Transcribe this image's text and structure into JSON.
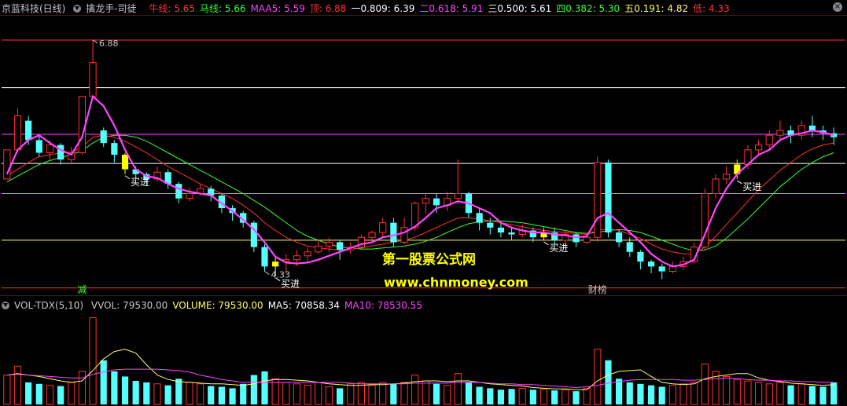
{
  "main_header": {
    "stock_name": "京蓝科技(日线)",
    "indicator_name": "擒龙手-司徒",
    "items": [
      {
        "label": "牛线: 5.65",
        "color": "#ff3333"
      },
      {
        "label": "马线: 5.66",
        "color": "#33ff33"
      },
      {
        "label": "MAA5: 5.59",
        "color": "#ff44ff"
      },
      {
        "label": "顶: 6.88",
        "color": "#ff3333"
      },
      {
        "label": "一0.809: 6.39",
        "color": "#ffffff"
      },
      {
        "label": "二0.618: 5.91",
        "color": "#ff44ff"
      },
      {
        "label": "三0.500: 5.61",
        "color": "#ffffff"
      },
      {
        "label": "四0.382: 5.30",
        "color": "#33ff33"
      },
      {
        "label": "五0.191: 4.82",
        "color": "#ffff66"
      },
      {
        "label": "低: 4.33",
        "color": "#ff3333"
      }
    ]
  },
  "sub_header": {
    "indicator_name": "VOL-TDX(5,10)",
    "items": [
      {
        "label": "VVOL: 79530.00",
        "color": "#c8c8c8"
      },
      {
        "label": "VOLUME: 79530.00",
        "color": "#ffff66"
      },
      {
        "label": "MA5: 70858.34",
        "color": "#ffffff"
      },
      {
        "label": "MA10: 78530.55",
        "color": "#ff44ff"
      }
    ]
  },
  "annotations": {
    "high_label": "6.88",
    "low_label": "4.33",
    "buy_label": "买进",
    "reduce_label": "减",
    "board_label": "财榜"
  },
  "watermark": {
    "line1": "第一股票公式网",
    "line2": "www.chnmoney.com"
  },
  "colors": {
    "up": "#ff3232",
    "down": "#54ffff",
    "signal": "#ffff00",
    "maa": "#ff44ff",
    "bull": "#ff3333",
    "horse": "#33ff33"
  },
  "chart_data": {
    "type": "candlestick",
    "price_levels": [
      {
        "name": "顶",
        "value": 6.88
      },
      {
        "name": "0.809",
        "value": 6.39
      },
      {
        "name": "0.618",
        "value": 5.91
      },
      {
        "name": "0.500",
        "value": 5.61
      },
      {
        "name": "0.382",
        "value": 5.3
      },
      {
        "name": "0.191",
        "value": 4.82
      },
      {
        "name": "低",
        "value": 4.33
      }
    ],
    "ylim": [
      4.27,
      7.13
    ],
    "candles": [
      [
        5.45,
        5.75,
        5.75,
        5.45
      ],
      [
        5.75,
        6.1,
        6.18,
        5.72
      ],
      [
        6.05,
        5.85,
        6.1,
        5.8
      ],
      [
        5.85,
        5.72,
        5.9,
        5.68
      ],
      [
        5.72,
        5.8,
        5.85,
        5.65
      ],
      [
        5.8,
        5.65,
        5.82,
        5.6
      ],
      [
        5.65,
        5.72,
        5.78,
        5.6
      ],
      [
        5.72,
        6.3,
        6.3,
        5.7
      ],
      [
        6.3,
        6.65,
        6.88,
        6.28
      ],
      [
        5.95,
        5.82,
        5.98,
        5.78
      ],
      [
        5.82,
        5.7,
        5.85,
        5.62
      ],
      [
        5.7,
        5.55,
        5.72,
        5.5
      ],
      [
        5.55,
        5.5,
        5.58,
        5.45
      ],
      [
        5.5,
        5.45,
        5.52,
        5.38
      ],
      [
        5.45,
        5.52,
        5.58,
        5.42
      ],
      [
        5.52,
        5.4,
        5.55,
        5.35
      ],
      [
        5.4,
        5.25,
        5.42,
        5.2
      ],
      [
        5.25,
        5.3,
        5.36,
        5.22
      ],
      [
        5.3,
        5.35,
        5.4,
        5.28
      ],
      [
        5.35,
        5.28,
        5.38,
        5.22
      ],
      [
        5.28,
        5.15,
        5.3,
        5.1
      ],
      [
        5.15,
        5.1,
        5.18,
        5.02
      ],
      [
        5.1,
        5.0,
        5.12,
        4.95
      ],
      [
        5.0,
        4.75,
        5.02,
        4.7
      ],
      [
        4.75,
        4.55,
        4.78,
        4.5
      ],
      [
        4.55,
        4.6,
        4.65,
        4.45
      ],
      [
        4.6,
        4.62,
        4.68,
        4.48
      ],
      [
        4.62,
        4.66,
        4.72,
        4.55
      ],
      [
        4.66,
        4.7,
        4.75,
        4.6
      ],
      [
        4.7,
        4.76,
        4.82,
        4.68
      ],
      [
        4.76,
        4.8,
        4.85,
        4.7
      ],
      [
        4.8,
        4.72,
        4.82,
        4.62
      ],
      [
        4.72,
        4.75,
        4.8,
        4.68
      ],
      [
        4.75,
        4.85,
        4.88,
        4.72
      ],
      [
        4.85,
        4.9,
        4.92,
        4.8
      ],
      [
        4.9,
        5.0,
        5.05,
        4.85
      ],
      [
        5.0,
        4.8,
        5.05,
        4.75
      ],
      [
        4.8,
        4.95,
        5.05,
        4.78
      ],
      [
        4.95,
        5.2,
        5.22,
        4.92
      ],
      [
        5.2,
        5.25,
        5.3,
        5.1
      ],
      [
        5.25,
        5.18,
        5.3,
        5.1
      ],
      [
        5.18,
        5.25,
        5.32,
        5.12
      ],
      [
        5.25,
        5.3,
        5.65,
        5.2
      ],
      [
        5.3,
        5.1,
        5.32,
        5.05
      ],
      [
        5.1,
        5.0,
        5.15,
        4.92
      ],
      [
        5.0,
        4.95,
        5.05,
        4.88
      ],
      [
        4.95,
        4.9,
        5.0,
        4.85
      ],
      [
        4.9,
        4.88,
        4.95,
        4.82
      ],
      [
        4.88,
        4.92,
        4.98,
        4.85
      ],
      [
        4.92,
        4.85,
        4.95,
        4.8
      ],
      [
        4.85,
        4.9,
        4.95,
        4.82
      ],
      [
        4.9,
        4.82,
        4.95,
        4.75
      ],
      [
        4.82,
        4.88,
        4.92,
        4.78
      ],
      [
        4.88,
        4.8,
        4.9,
        4.75
      ],
      [
        4.8,
        4.85,
        4.9,
        4.78
      ],
      [
        4.85,
        5.62,
        5.68,
        4.8
      ],
      [
        5.62,
        4.9,
        5.65,
        4.85
      ],
      [
        4.9,
        4.8,
        4.92,
        4.75
      ],
      [
        4.8,
        4.7,
        4.85,
        4.65
      ],
      [
        4.7,
        4.6,
        4.72,
        4.52
      ],
      [
        4.6,
        4.55,
        4.62,
        4.48
      ],
      [
        4.55,
        4.5,
        4.58,
        4.42
      ],
      [
        4.5,
        4.55,
        4.6,
        4.48
      ],
      [
        4.55,
        4.6,
        4.65,
        4.52
      ],
      [
        4.6,
        4.75,
        4.8,
        4.58
      ],
      [
        4.75,
        5.3,
        5.35,
        4.72
      ],
      [
        5.3,
        5.45,
        5.5,
        5.25
      ],
      [
        5.45,
        5.5,
        5.58,
        5.4
      ],
      [
        5.5,
        5.6,
        5.65,
        5.45
      ],
      [
        5.6,
        5.75,
        5.8,
        5.55
      ],
      [
        5.75,
        5.8,
        5.85,
        5.7
      ],
      [
        5.8,
        5.9,
        5.95,
        5.75
      ],
      [
        5.9,
        5.95,
        6.05,
        5.85
      ],
      [
        5.95,
        5.9,
        6.0,
        5.82
      ],
      [
        5.9,
        6.0,
        6.05,
        5.85
      ],
      [
        6.0,
        5.95,
        6.1,
        5.88
      ],
      [
        5.95,
        5.92,
        6.0,
        5.85
      ],
      [
        5.92,
        5.88,
        5.98,
        5.8
      ]
    ],
    "buy_signals": [
      11,
      25,
      50,
      68
    ],
    "volume": {
      "ylim": [
        0,
        125000
      ],
      "values": [
        40000,
        52000,
        30000,
        28000,
        26000,
        25000,
        30000,
        45000,
        118000,
        60000,
        45000,
        38000,
        32000,
        30000,
        28000,
        26000,
        35000,
        30000,
        28000,
        25000,
        24000,
        22000,
        28000,
        40000,
        45000,
        35000,
        30000,
        28000,
        26000,
        30000,
        24000,
        22000,
        28000,
        30000,
        26000,
        30000,
        28000,
        30000,
        40000,
        32000,
        28000,
        26000,
        42000,
        30000,
        24000,
        22000,
        20000,
        21000,
        22000,
        20000,
        21000,
        19000,
        20000,
        18000,
        22000,
        75000,
        60000,
        35000,
        30000,
        28000,
        26000,
        24000,
        26000,
        28000,
        30000,
        55000,
        45000,
        38000,
        34000,
        32000,
        30000,
        28000,
        30000,
        26000,
        28000,
        25000,
        24000,
        30000
      ],
      "ma5": [
        40000,
        42000,
        40000,
        38000,
        35000,
        32000,
        30000,
        32000,
        46000,
        62000,
        72000,
        75000,
        70000,
        54000,
        40000,
        34000,
        31000,
        30000,
        29000,
        28000,
        28000,
        27000,
        26000,
        28000,
        32000,
        34000,
        34000,
        33000,
        32000,
        30000,
        28000,
        27000,
        26000,
        26000,
        27000,
        27000,
        28000,
        29000,
        31000,
        32000,
        32000,
        31000,
        32000,
        32000,
        30000,
        28000,
        27000,
        26000,
        25000,
        23000,
        22000,
        21000,
        21000,
        20000,
        20000,
        32000,
        40000,
        45000,
        46000,
        47000,
        38000,
        30000,
        28000,
        27000,
        28000,
        35000,
        38000,
        40000,
        42000,
        42000,
        36000,
        33000,
        31000,
        29000,
        28000,
        27000,
        26000,
        27000
      ],
      "ma10": [
        40000,
        41000,
        40000,
        39000,
        38000,
        37000,
        36000,
        36000,
        41000,
        44000,
        47000,
        48000,
        48000,
        48000,
        48000,
        47000,
        46000,
        44000,
        40000,
        37000,
        34000,
        32000,
        30000,
        30000,
        30000,
        30000,
        30000,
        30000,
        30000,
        30000,
        30000,
        30000,
        29000,
        28000,
        28000,
        28000,
        28000,
        28000,
        29000,
        29000,
        29000,
        29000,
        30000,
        30000,
        30000,
        29000,
        28000,
        28000,
        27000,
        27000,
        26000,
        25000,
        24000,
        23000,
        24000,
        26000,
        29000,
        31000,
        33000,
        34000,
        34000,
        34000,
        34000,
        33000,
        33000,
        34000,
        35000,
        36000,
        35000,
        34000,
        33000,
        33000,
        32000,
        32000,
        31000,
        31000,
        30000,
        30000
      ]
    },
    "maa5": [
      5.5,
      5.75,
      5.85,
      5.9,
      5.82,
      5.75,
      5.7,
      5.88,
      6.3,
      6.2,
      6.0,
      5.75,
      5.55,
      5.48,
      5.46,
      5.4,
      5.35,
      5.32,
      5.3,
      5.28,
      5.2,
      5.12,
      5.03,
      4.93,
      4.8,
      4.65,
      4.59,
      4.58,
      4.59,
      4.62,
      4.66,
      4.7,
      4.74,
      4.78,
      4.8,
      4.85,
      4.87,
      4.9,
      4.96,
      5.05,
      5.15,
      5.18,
      5.22,
      5.2,
      5.15,
      5.1,
      5.0,
      4.95,
      4.92,
      4.9,
      4.9,
      4.88,
      4.87,
      4.85,
      4.86,
      5.05,
      5.1,
      5.0,
      4.9,
      4.8,
      4.68,
      4.6,
      4.55,
      4.57,
      4.62,
      4.88,
      5.15,
      5.35,
      5.5,
      5.6,
      5.7,
      5.75,
      5.85,
      5.9,
      5.92,
      5.95,
      5.93,
      5.9
    ],
    "bull_line": [
      5.48,
      5.55,
      5.62,
      5.68,
      5.7,
      5.72,
      5.72,
      5.78,
      5.88,
      5.9,
      5.88,
      5.84,
      5.78,
      5.72,
      5.65,
      5.58,
      5.52,
      5.46,
      5.4,
      5.35,
      5.3,
      5.25,
      5.18,
      5.1,
      5.0,
      4.92,
      4.85,
      4.8,
      4.76,
      4.74,
      4.73,
      4.72,
      4.73,
      4.74,
      4.76,
      4.78,
      4.8,
      4.82,
      4.85,
      4.9,
      4.95,
      5.0,
      5.05,
      5.05,
      5.04,
      5.02,
      5.0,
      4.98,
      4.96,
      4.94,
      4.92,
      4.91,
      4.9,
      4.89,
      4.88,
      4.92,
      4.94,
      4.92,
      4.88,
      4.84,
      4.78,
      4.73,
      4.7,
      4.68,
      4.68,
      4.75,
      4.86,
      4.98,
      5.1,
      5.22,
      5.34,
      5.44,
      5.54,
      5.62,
      5.7,
      5.76,
      5.8,
      5.82
    ],
    "horse_line": [
      5.42,
      5.48,
      5.54,
      5.6,
      5.64,
      5.67,
      5.7,
      5.74,
      5.82,
      5.88,
      5.9,
      5.9,
      5.88,
      5.84,
      5.78,
      5.72,
      5.66,
      5.6,
      5.54,
      5.48,
      5.42,
      5.36,
      5.3,
      5.23,
      5.16,
      5.08,
      5.0,
      4.92,
      4.86,
      4.82,
      4.78,
      4.75,
      4.74,
      4.73,
      4.73,
      4.74,
      4.75,
      4.76,
      4.78,
      4.81,
      4.85,
      4.9,
      4.95,
      4.99,
      5.01,
      5.02,
      5.02,
      5.01,
      5.0,
      4.98,
      4.96,
      4.94,
      4.92,
      4.9,
      4.89,
      4.9,
      4.92,
      4.93,
      4.92,
      4.9,
      4.86,
      4.82,
      4.78,
      4.74,
      4.71,
      4.72,
      4.76,
      4.84,
      4.94,
      5.04,
      5.15,
      5.26,
      5.37,
      5.46,
      5.55,
      5.62,
      5.68,
      5.72
    ]
  }
}
